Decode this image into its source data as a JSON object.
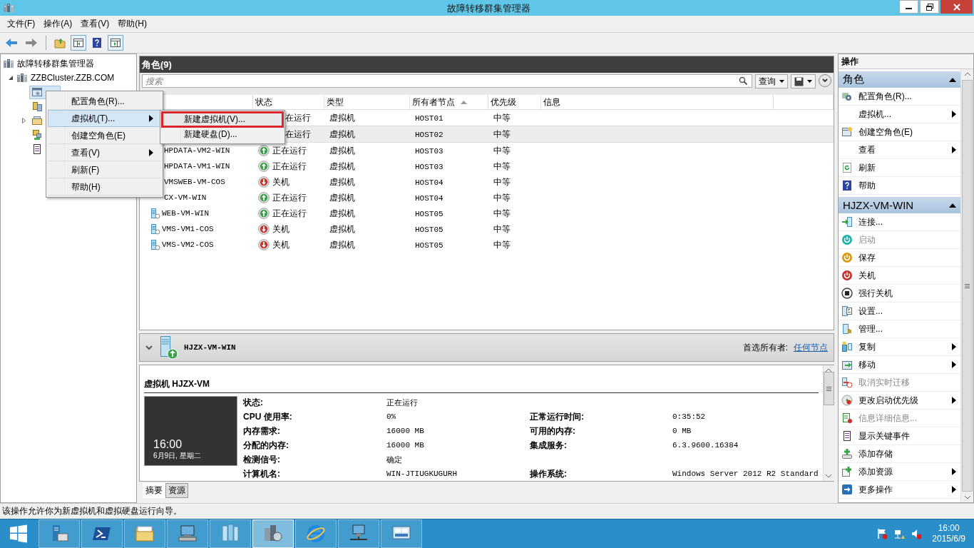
{
  "window": {
    "title": "故障转移群集管理器"
  },
  "menu": [
    "文件(F)",
    "操作(A)",
    "查看(V)",
    "帮助(H)"
  ],
  "tree": {
    "label": "故障转移群集管理器",
    "children": [
      {
        "label": "ZZBCluster.ZZB.COM",
        "expanded": true,
        "children": [
          {
            "kind": "roles",
            "selected": true,
            "expandable": false
          },
          {
            "kind": "nodes",
            "selected": false,
            "expandable": false
          },
          {
            "kind": "storage",
            "selected": false,
            "expandable": true
          },
          {
            "kind": "networks",
            "selected": false,
            "expandable": false
          },
          {
            "kind": "events",
            "selected": false,
            "expandable": false
          }
        ]
      }
    ]
  },
  "roles": {
    "title": "角色(9)",
    "search": {
      "placeholder": "搜索"
    },
    "query_button": "查询",
    "columns": [
      {
        "label": "状态",
        "sorted": false
      },
      {
        "label": "类型",
        "sorted": false
      },
      {
        "label": "所有者节点",
        "sorted": true
      },
      {
        "label": "优先级",
        "sorted": false
      },
      {
        "label": "信息",
        "sorted": false
      }
    ],
    "rows": [
      {
        "status": "在运行",
        "type": "虚拟机",
        "owner": "HOST01",
        "priority": "中等",
        "selected": false
      },
      {
        "status": "在运行",
        "type": "虚拟机",
        "owner": "HOST02",
        "priority": "中等",
        "selected": true
      },
      {
        "name": "HPDATA-VM2-WIN",
        "icon": false,
        "kind": "running",
        "status": "正在运行",
        "type": "虚拟机",
        "owner": "HOST03",
        "priority": "中等",
        "selected": false
      },
      {
        "name": "HPDATA-VM1-WIN",
        "icon": false,
        "kind": "running",
        "status": "正在运行",
        "type": "虚拟机",
        "owner": "HOST03",
        "priority": "中等",
        "selected": false
      },
      {
        "name": "VMSWEB-VM-COS",
        "icon": false,
        "kind": "off",
        "status": "关机",
        "type": "虚拟机",
        "owner": "HOST04",
        "priority": "中等",
        "selected": false
      },
      {
        "name": "CX-VM-WIN",
        "icon": false,
        "kind": "running",
        "status": "正在运行",
        "type": "虚拟机",
        "owner": "HOST04",
        "priority": "中等",
        "selected": false
      },
      {
        "name": "WEB-VM-WIN",
        "icon": true,
        "kind": "running",
        "status": "正在运行",
        "type": "虚拟机",
        "owner": "HOST05",
        "priority": "中等",
        "selected": false
      },
      {
        "name": "VMS-VM1-COS",
        "icon": true,
        "kind": "off",
        "status": "关机",
        "type": "虚拟机",
        "owner": "HOST05",
        "priority": "中等",
        "selected": false
      },
      {
        "name": "VMS-VM2-COS",
        "icon": true,
        "kind": "off",
        "status": "关机",
        "type": "虚拟机",
        "owner": "HOST05",
        "priority": "中等",
        "selected": false
      }
    ]
  },
  "detail": {
    "name": "HJZX-VM-WIN",
    "preferred_owner_label": "首选所有者:",
    "preferred_owner": "任何节点",
    "heading": "虚拟机 HJZX-VM",
    "thumbnail": {
      "time": "16:00",
      "date": "6月9日, 星期二"
    },
    "properties": [
      {
        "left": {
          "label": "状态:",
          "value": "正在运行"
        }
      },
      {
        "left": {
          "label": "CPU 使用率:",
          "value": "0%"
        },
        "right": {
          "label": "正常运行时间:",
          "value": "0:35:52"
        }
      },
      {
        "left": {
          "label": "内存需求:",
          "value": "16000 MB"
        },
        "right": {
          "label": "可用的内存:",
          "value": "0 MB"
        }
      },
      {
        "left": {
          "label": "分配的内存:",
          "value": "16000 MB"
        },
        "right": {
          "label": "集成服务:",
          "value": "6.3.9600.16384"
        }
      },
      {
        "left": {
          "label": "检测信号:",
          "value": "确定"
        }
      },
      {
        "left": {
          "label": "计算机名:",
          "value": "WIN-JTIUGKUGURH"
        },
        "right": {
          "label": "操作系统:",
          "value": "Windows Server 2012 R2 Standard"
        }
      }
    ],
    "tabs": [
      {
        "label": "摘要",
        "selected": true
      },
      {
        "label": "资源",
        "selected": false
      }
    ]
  },
  "actions": {
    "title": "操作",
    "sections": [
      {
        "title": "角色",
        "expanded": true,
        "items": [
          {
            "label": "配置角色(R)...",
            "disabled": false,
            "submenu": false
          },
          {
            "label": "虚拟机...",
            "disabled": false,
            "submenu": true
          },
          {
            "label": "创建空角色(E)",
            "disabled": false,
            "submenu": false
          },
          {
            "label": "查看",
            "disabled": false,
            "submenu": true
          },
          {
            "label": "刷新",
            "disabled": false,
            "submenu": false
          },
          {
            "label": "帮助",
            "disabled": false,
            "submenu": false
          }
        ]
      },
      {
        "title": "HJZX-VM-WIN",
        "expanded": true,
        "items": [
          {
            "label": "连接...",
            "disabled": false,
            "submenu": false
          },
          {
            "label": "启动",
            "disabled": true,
            "submenu": false
          },
          {
            "label": "保存",
            "disabled": false,
            "submenu": false
          },
          {
            "label": "关机",
            "disabled": false,
            "submenu": false
          },
          {
            "label": "强行关机",
            "disabled": false,
            "submenu": false
          },
          {
            "label": "设置...",
            "disabled": false,
            "submenu": false
          },
          {
            "label": "管理...",
            "disabled": false,
            "submenu": false
          },
          {
            "label": "复制",
            "disabled": false,
            "submenu": true
          },
          {
            "label": "移动",
            "disabled": false,
            "submenu": true
          },
          {
            "label": "取消实时迁移",
            "disabled": true,
            "submenu": false
          },
          {
            "label": "更改启动优先级",
            "disabled": false,
            "submenu": true
          },
          {
            "label": "信息详细信息...",
            "disabled": true,
            "submenu": false
          },
          {
            "label": "显示关键事件",
            "disabled": false,
            "submenu": false
          },
          {
            "label": "添加存储",
            "disabled": false,
            "submenu": false
          },
          {
            "label": "添加资源",
            "disabled": false,
            "submenu": true
          },
          {
            "label": "更多操作",
            "disabled": false,
            "submenu": true
          }
        ]
      }
    ]
  },
  "context_menu": {
    "items": [
      {
        "label": "配置角色(R)...",
        "selected": false,
        "submenu": false
      },
      {
        "label": "虚拟机(T)...",
        "selected": true,
        "submenu": true
      },
      {
        "label": "创建空角色(E)",
        "selected": false,
        "submenu": false
      },
      {
        "label": "查看(V)",
        "selected": false,
        "submenu": true
      },
      {
        "label": "刷新(F)",
        "selected": false,
        "submenu": false
      },
      {
        "label": "帮助(H)",
        "selected": false,
        "submenu": false
      }
    ],
    "submenu": {
      "items": [
        {
          "label": "新建虚拟机(V)...",
          "selected": true
        },
        {
          "label": "新建硬盘(D)...",
          "selected": false
        }
      ]
    }
  },
  "status_bar": "该操作允许你为新虚拟机和虚拟硬盘运行向导。",
  "taskbar": {
    "apps": [
      {
        "selected": false
      },
      {
        "selected": false
      },
      {
        "selected": false
      },
      {
        "selected": false
      },
      {
        "selected": false
      },
      {
        "selected": false
      },
      {
        "selected": true
      },
      {
        "selected": false
      },
      {
        "selected": false
      },
      {
        "selected": false
      }
    ],
    "time": "16:00",
    "date": "2015/6/9"
  }
}
